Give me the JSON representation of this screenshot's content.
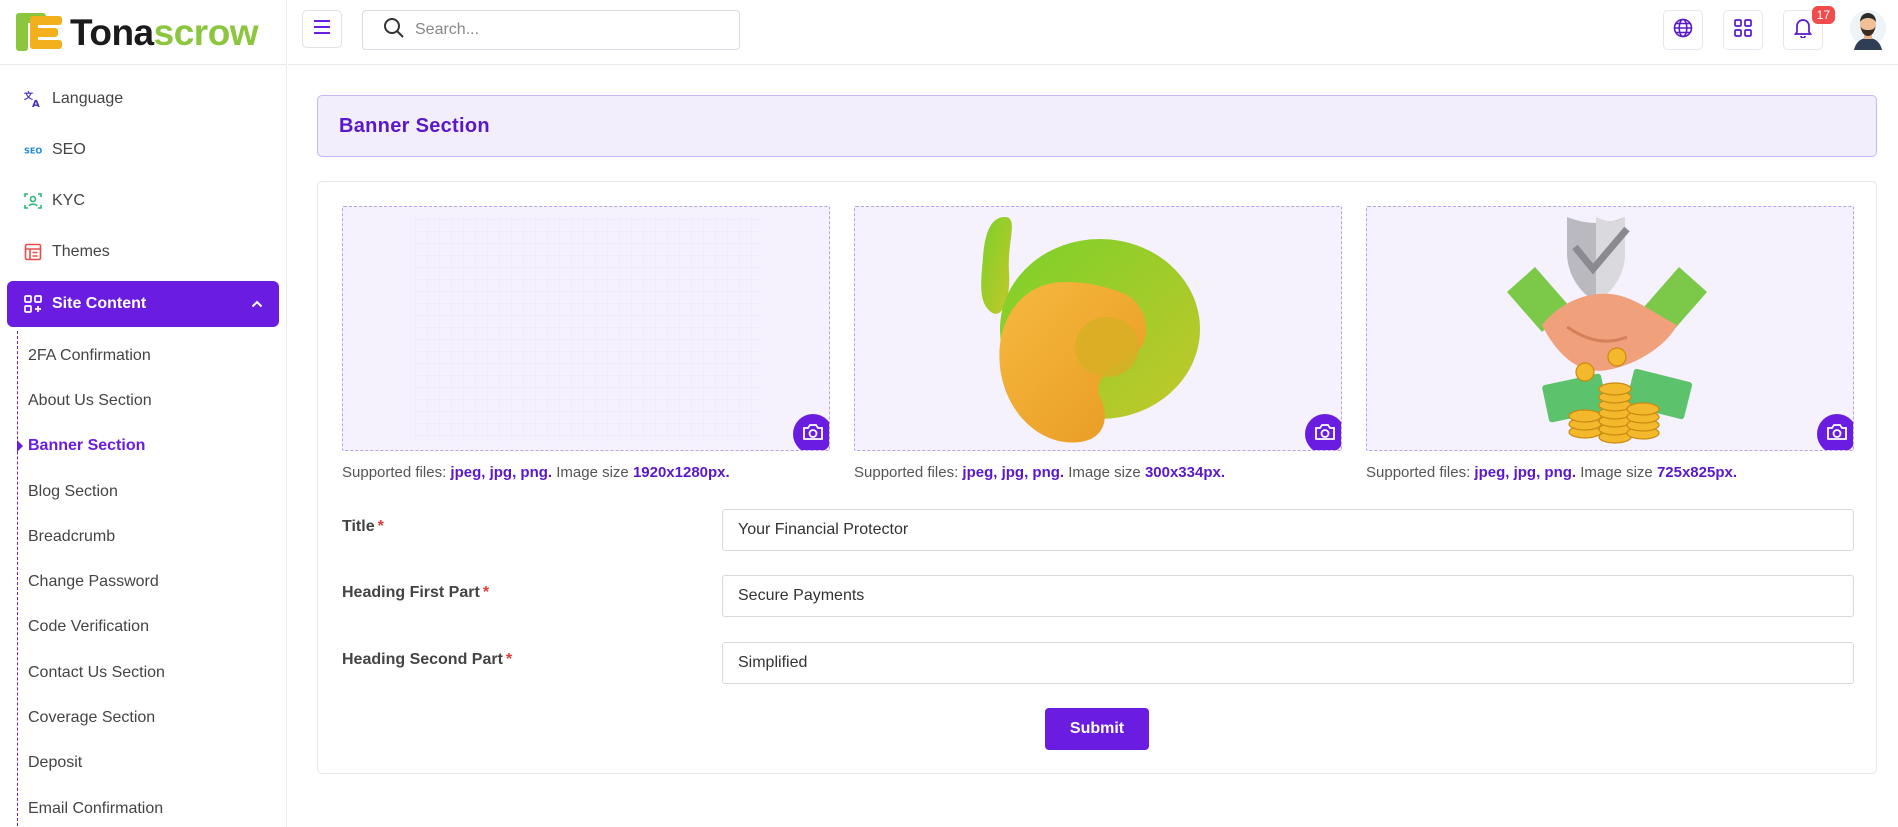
{
  "brand": {
    "name_part1": "Tona",
    "name_part2": "scrow"
  },
  "header": {
    "search_placeholder": "Search...",
    "notification_count": "17"
  },
  "sidebar": {
    "items": [
      {
        "label": "Language",
        "icon": "translate-icon"
      },
      {
        "label": "SEO",
        "icon": "seo-icon"
      },
      {
        "label": "KYC",
        "icon": "face-scan-icon"
      },
      {
        "label": "Themes",
        "icon": "themes-icon"
      }
    ],
    "active": {
      "label": "Site Content",
      "icon": "grid-plus-icon"
    },
    "sub_items": [
      "2FA Confirmation",
      "About Us Section",
      "Banner Section",
      "Blog Section",
      "Breadcrumb",
      "Change Password",
      "Code Verification",
      "Contact Us Section",
      "Coverage Section",
      "Deposit",
      "Email Confirmation"
    ],
    "current_sub": "Banner Section"
  },
  "main": {
    "section_title": "Banner Section",
    "uploads": [
      {
        "prefix": "Supported files: ",
        "types": "jpeg, jpg, png.",
        "size_label": " Image size ",
        "size": "1920x1280px."
      },
      {
        "prefix": "Supported files: ",
        "types": "jpeg, jpg, png.",
        "size_label": " Image size ",
        "size": "300x334px."
      },
      {
        "prefix": "Supported files: ",
        "types": "jpeg, jpg, png.",
        "size_label": " Image size ",
        "size": "725x825px."
      }
    ],
    "fields": [
      {
        "label": "Title",
        "value": "Your Financial Protector"
      },
      {
        "label": "Heading First Part",
        "value": "Secure Payments"
      },
      {
        "label": "Heading Second Part",
        "value": "Simplified"
      }
    ],
    "required_mark": "*",
    "submit_label": "Submit"
  },
  "colors": {
    "accent": "#6a1de0",
    "brand_green": "#8cc63f",
    "badge": "#f14b4b"
  }
}
